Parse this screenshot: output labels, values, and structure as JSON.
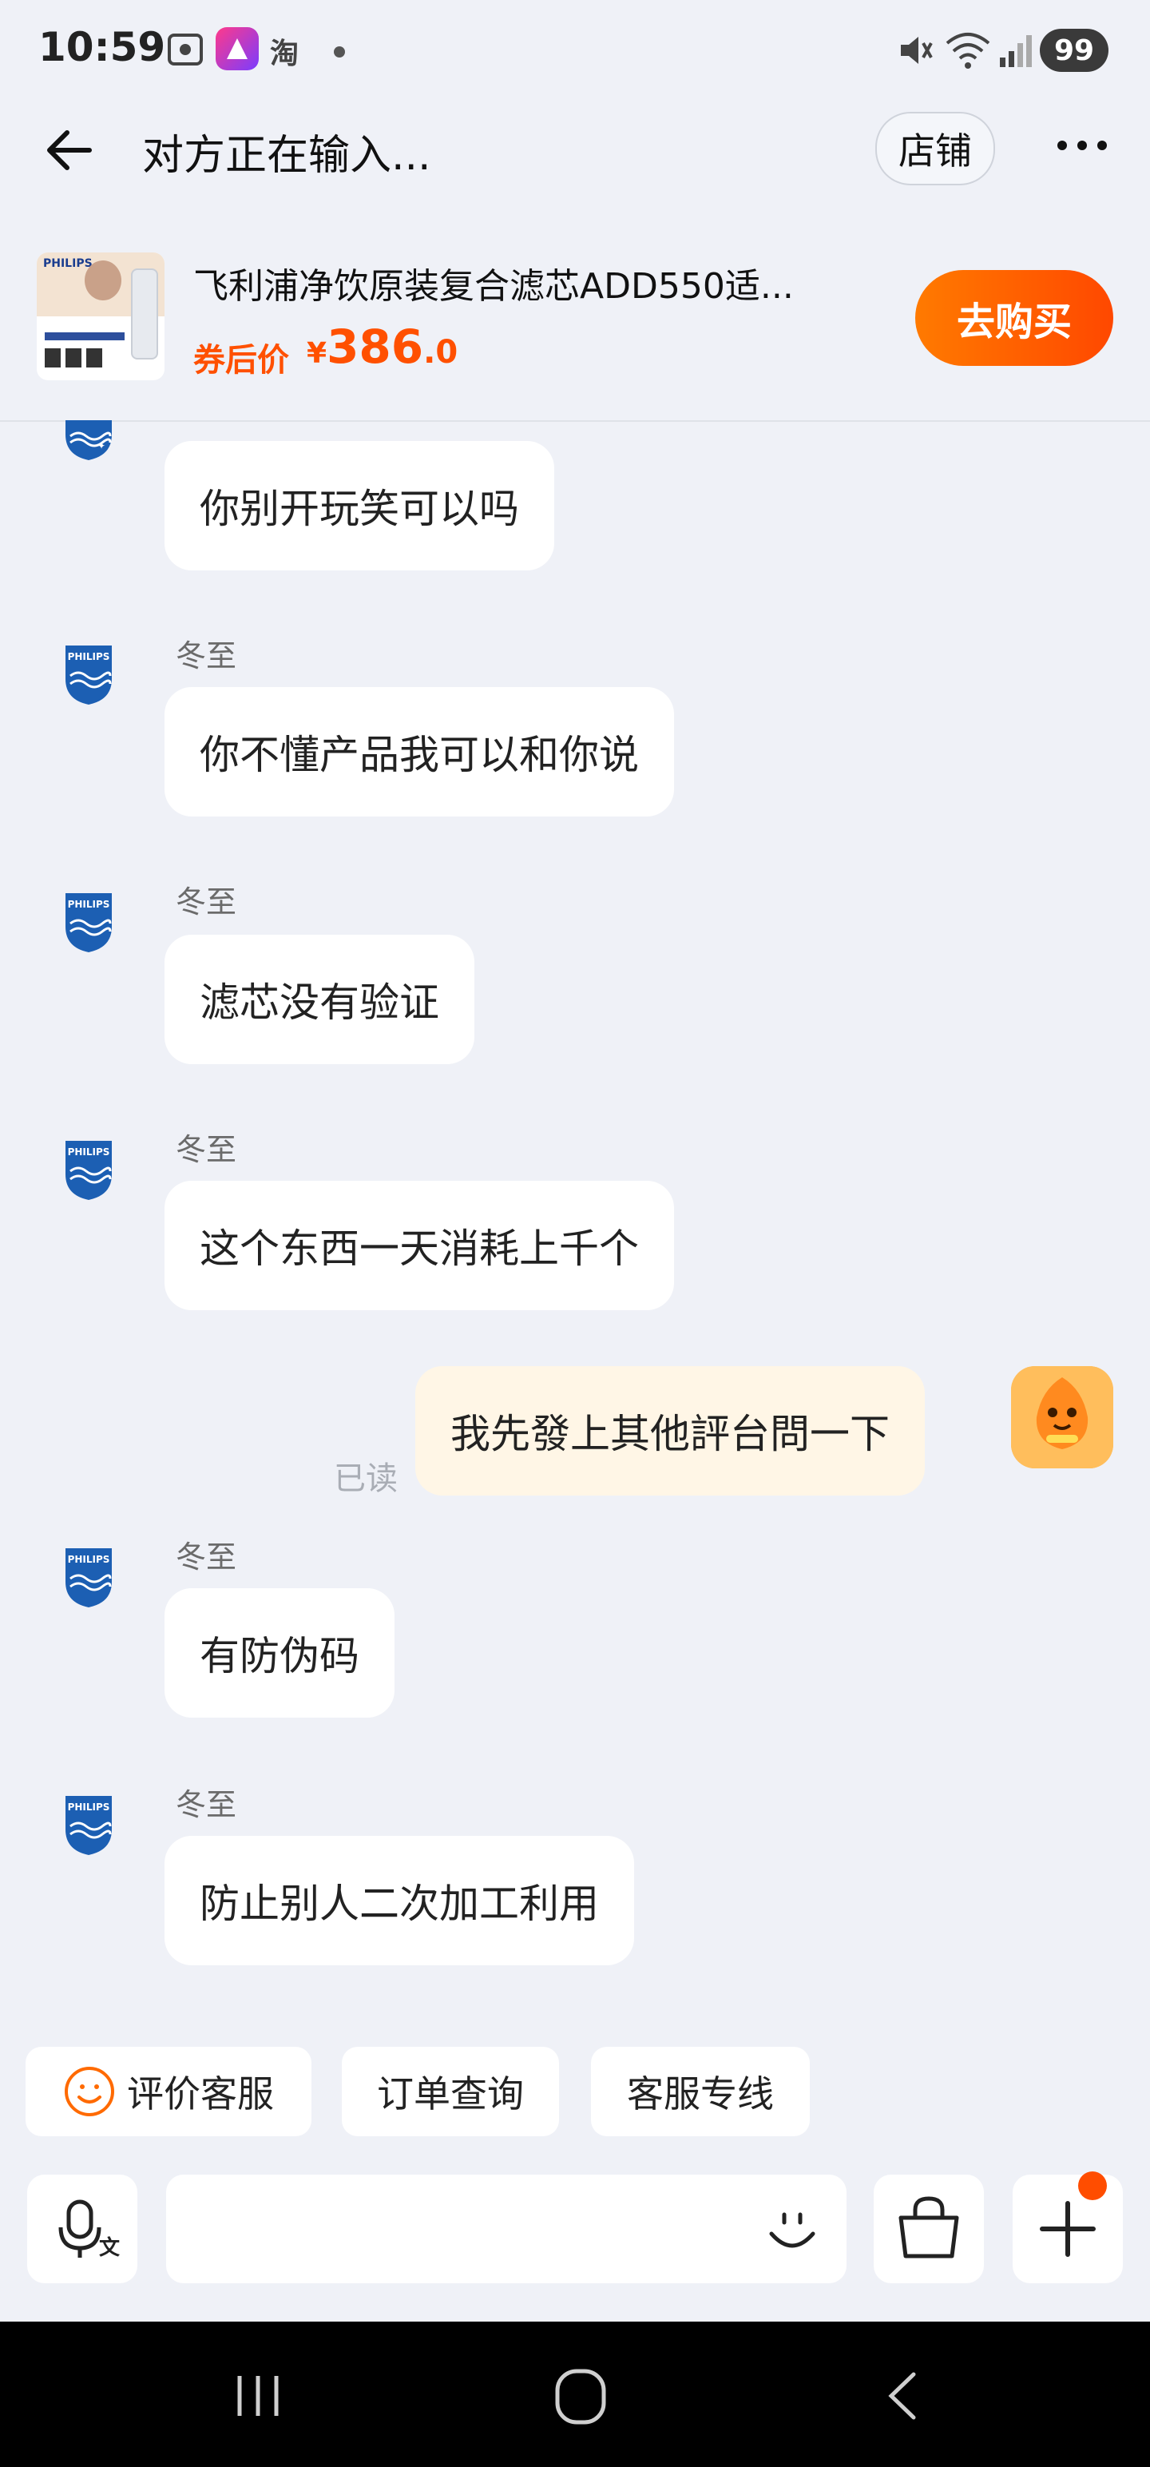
{
  "status_bar": {
    "time": "10:59",
    "app_badge_text": "淘",
    "battery": "99",
    "icons": [
      "screenshot-icon",
      "app-icon",
      "taobao-icon",
      "dot-icon",
      "mute-icon",
      "wifi-icon",
      "signal-icon",
      "battery-icon"
    ]
  },
  "header": {
    "title": "对方正在输入...",
    "shop_label": "店铺"
  },
  "product": {
    "title": "飞利浦净饮原装复合滤芯ADD550适...",
    "price_label": "券后价",
    "currency": "¥",
    "price_int": "386",
    "price_dec": ".0",
    "buy_label": "去购买",
    "thumb_brand": "PHILIPS"
  },
  "messages": [
    {
      "from": "them",
      "sender": "",
      "text": "你别开玩笑可以吗"
    },
    {
      "from": "them",
      "sender": "冬至",
      "text": "你不懂产品我可以和你说"
    },
    {
      "from": "them",
      "sender": "冬至",
      "text": "滤芯没有验证"
    },
    {
      "from": "them",
      "sender": "冬至",
      "text": "这个东西一天消耗上千个"
    },
    {
      "from": "me",
      "text": "我先發上其他評台問一下",
      "status": "已读"
    },
    {
      "from": "them",
      "sender": "冬至",
      "text": "有防伪码"
    },
    {
      "from": "them",
      "sender": "冬至",
      "text": "防止别人二次加工利用"
    }
  ],
  "brand_logo_text": "PHILIPS",
  "quick_replies": [
    "评价客服",
    "订单查询",
    "客服专线"
  ],
  "colors": {
    "accent": "#ff5000",
    "background": "#eff1f7",
    "my_bubble": "#fff6e6"
  }
}
